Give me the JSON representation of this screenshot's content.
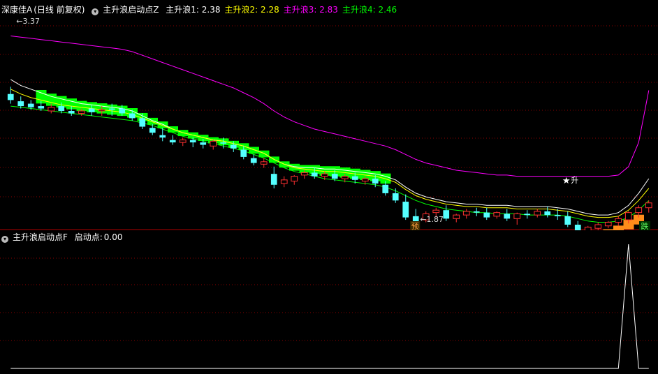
{
  "main_panel": {
    "stock_name": "深康佳A",
    "period_label": "(日线 前复权)",
    "indicator_name": "主升浪启动点Z",
    "lines": [
      {
        "label": "主升浪1:",
        "value": "2.38",
        "color": "#ffffff"
      },
      {
        "label": "主升浪2:",
        "value": "2.28",
        "color": "#ffff00"
      },
      {
        "label": "主升浪3:",
        "value": "2.83",
        "color": "#ff00ff"
      },
      {
        "label": "主升浪4:",
        "value": "2.46",
        "color": "#00ff00"
      }
    ],
    "price_high_label": "3.37",
    "price_low_label": "1.87",
    "marker_yu": "预",
    "marker_die": "跌",
    "marker_sheng": "升"
  },
  "sub_panel": {
    "indicator_name": "主升浪启动点F",
    "series_label": "启动点:",
    "series_value": "0.00"
  },
  "colors": {
    "up": "#ff3030",
    "down": "#54ffff",
    "band": "#00ff00",
    "orange": "#ff8c1a",
    "grid": "#8b0000"
  },
  "chart_data": [
    {
      "type": "candlestick",
      "title": "主升浪启动点Z",
      "ylim": [
        1.72,
        3.45
      ],
      "candles": [
        [
          2.8,
          2.86,
          2.75,
          2.72
        ],
        [
          2.74,
          2.78,
          2.7,
          2.68
        ],
        [
          2.72,
          2.75,
          2.69,
          2.67
        ],
        [
          2.7,
          2.74,
          2.68,
          2.66
        ],
        [
          2.66,
          2.72,
          2.69,
          2.64
        ],
        [
          2.7,
          2.73,
          2.66,
          2.64
        ],
        [
          2.66,
          2.7,
          2.64,
          2.62
        ],
        [
          2.64,
          2.68,
          2.66,
          2.62
        ],
        [
          2.68,
          2.71,
          2.65,
          2.62
        ],
        [
          2.66,
          2.7,
          2.67,
          2.62
        ],
        [
          2.68,
          2.72,
          2.67,
          2.62
        ],
        [
          2.68,
          2.71,
          2.64,
          2.62
        ],
        [
          2.64,
          2.67,
          2.6,
          2.58
        ],
        [
          2.6,
          2.64,
          2.53,
          2.51
        ],
        [
          2.52,
          2.55,
          2.48,
          2.46
        ],
        [
          2.46,
          2.52,
          2.44,
          2.41
        ],
        [
          2.42,
          2.46,
          2.4,
          2.38
        ],
        [
          2.4,
          2.44,
          2.42,
          2.37
        ],
        [
          2.42,
          2.44,
          2.4,
          2.36
        ],
        [
          2.4,
          2.43,
          2.38,
          2.35
        ],
        [
          2.37,
          2.42,
          2.41,
          2.34
        ],
        [
          2.4,
          2.44,
          2.39,
          2.35
        ],
        [
          2.38,
          2.41,
          2.35,
          2.32
        ],
        [
          2.34,
          2.37,
          2.28,
          2.26
        ],
        [
          2.27,
          2.3,
          2.23,
          2.21
        ],
        [
          2.22,
          2.27,
          2.24,
          2.19
        ],
        [
          2.14,
          2.2,
          2.05,
          2.02
        ],
        [
          2.06,
          2.12,
          2.09,
          2.03
        ],
        [
          2.08,
          2.13,
          2.12,
          2.05
        ],
        [
          2.13,
          2.17,
          2.15,
          2.1
        ],
        [
          2.15,
          2.19,
          2.12,
          2.1
        ],
        [
          2.12,
          2.16,
          2.14,
          2.09
        ],
        [
          2.14,
          2.17,
          2.1,
          2.08
        ],
        [
          2.1,
          2.14,
          2.12,
          2.07
        ],
        [
          2.12,
          2.15,
          2.09,
          2.06
        ],
        [
          2.08,
          2.12,
          2.1,
          2.05
        ],
        [
          2.1,
          2.13,
          2.06,
          2.03
        ],
        [
          2.05,
          2.08,
          1.98,
          1.96
        ],
        [
          1.98,
          2.02,
          1.92,
          1.9
        ],
        [
          1.91,
          1.97,
          1.78,
          1.76
        ],
        [
          1.79,
          1.85,
          1.74,
          1.72
        ],
        [
          1.76,
          1.83,
          1.81,
          1.74
        ],
        [
          1.82,
          1.86,
          1.84,
          1.78
        ],
        [
          1.84,
          1.88,
          1.77,
          1.75
        ],
        [
          1.77,
          1.81,
          1.8,
          1.74
        ],
        [
          1.8,
          1.85,
          1.83,
          1.77
        ],
        [
          1.83,
          1.86,
          1.82,
          1.79
        ],
        [
          1.82,
          1.86,
          1.78,
          1.76
        ],
        [
          1.79,
          1.83,
          1.82,
          1.77
        ],
        [
          1.81,
          1.85,
          1.77,
          1.75
        ],
        [
          1.77,
          1.82,
          1.81,
          1.72
        ],
        [
          1.81,
          1.84,
          1.8,
          1.77
        ],
        [
          1.8,
          1.85,
          1.83,
          1.78
        ],
        [
          1.83,
          1.87,
          1.8,
          1.78
        ],
        [
          1.8,
          1.85,
          1.79,
          1.76
        ],
        [
          1.79,
          1.83,
          1.72,
          1.7
        ],
        [
          1.72,
          1.75,
          1.67,
          1.65
        ],
        [
          1.67,
          1.71,
          1.7,
          1.64
        ],
        [
          1.69,
          1.74,
          1.72,
          1.67
        ],
        [
          1.71,
          1.75,
          1.74,
          1.69
        ],
        [
          1.74,
          1.79,
          1.77,
          1.71
        ],
        [
          1.76,
          1.83,
          1.82,
          1.73
        ],
        [
          1.82,
          1.88,
          1.86,
          1.78
        ],
        [
          1.86,
          1.92,
          1.9,
          1.82
        ]
      ],
      "lines": [
        {
          "name": "主升浪1",
          "color": "#ffffff",
          "values": [
            2.92,
            2.87,
            2.84,
            2.81,
            2.78,
            2.76,
            2.74,
            2.72,
            2.71,
            2.7,
            2.69,
            2.68,
            2.66,
            2.62,
            2.58,
            2.55,
            2.51,
            2.48,
            2.46,
            2.44,
            2.42,
            2.41,
            2.39,
            2.37,
            2.34,
            2.31,
            2.26,
            2.22,
            2.2,
            2.19,
            2.19,
            2.18,
            2.18,
            2.17,
            2.16,
            2.15,
            2.14,
            2.12,
            2.09,
            2.03,
            1.98,
            1.95,
            1.93,
            1.91,
            1.9,
            1.89,
            1.89,
            1.88,
            1.88,
            1.88,
            1.87,
            1.87,
            1.87,
            1.87,
            1.86,
            1.85,
            1.83,
            1.81,
            1.8,
            1.8,
            1.82,
            1.88,
            1.98,
            2.1
          ]
        },
        {
          "name": "主升浪2",
          "color": "#ffff00",
          "values": [
            2.84,
            2.8,
            2.77,
            2.75,
            2.73,
            2.71,
            2.7,
            2.69,
            2.68,
            2.67,
            2.66,
            2.65,
            2.63,
            2.6,
            2.57,
            2.54,
            2.51,
            2.48,
            2.46,
            2.44,
            2.42,
            2.41,
            2.39,
            2.37,
            2.34,
            2.31,
            2.26,
            2.22,
            2.19,
            2.18,
            2.17,
            2.16,
            2.16,
            2.15,
            2.14,
            2.13,
            2.12,
            2.1,
            2.07,
            2.01,
            1.96,
            1.93,
            1.91,
            1.89,
            1.88,
            1.87,
            1.87,
            1.86,
            1.86,
            1.86,
            1.85,
            1.85,
            1.85,
            1.85,
            1.84,
            1.83,
            1.81,
            1.79,
            1.78,
            1.78,
            1.79,
            1.84,
            1.92,
            2.02
          ]
        },
        {
          "name": "主升浪3",
          "color": "#ff00ff",
          "values": [
            3.28,
            3.27,
            3.26,
            3.25,
            3.24,
            3.23,
            3.22,
            3.21,
            3.2,
            3.19,
            3.18,
            3.17,
            3.15,
            3.12,
            3.09,
            3.06,
            3.03,
            3.0,
            2.97,
            2.94,
            2.91,
            2.88,
            2.85,
            2.81,
            2.77,
            2.72,
            2.66,
            2.61,
            2.57,
            2.54,
            2.51,
            2.49,
            2.47,
            2.45,
            2.43,
            2.41,
            2.39,
            2.37,
            2.34,
            2.3,
            2.26,
            2.23,
            2.21,
            2.19,
            2.17,
            2.16,
            2.15,
            2.14,
            2.13,
            2.13,
            2.12,
            2.12,
            2.12,
            2.12,
            2.12,
            2.12,
            2.12,
            2.12,
            2.12,
            2.12,
            2.13,
            2.2,
            2.4,
            2.83
          ]
        },
        {
          "name": "主升浪4",
          "color": "#00ff00",
          "values": [
            2.7,
            2.69,
            2.68,
            2.67,
            2.66,
            2.65,
            2.64,
            2.63,
            2.62,
            2.61,
            2.6,
            2.59,
            2.58,
            2.56,
            2.54,
            2.51,
            2.48,
            2.45,
            2.43,
            2.41,
            2.39,
            2.37,
            2.35,
            2.33,
            2.3,
            2.27,
            2.23,
            2.19,
            2.16,
            2.14,
            2.12,
            2.1,
            2.09,
            2.08,
            2.07,
            2.06,
            2.05,
            2.03,
            2.0,
            1.96,
            1.92,
            1.89,
            1.87,
            1.85,
            1.84,
            1.83,
            1.82,
            1.82,
            1.81,
            1.81,
            1.81,
            1.8,
            1.8,
            1.8,
            1.8,
            1.79,
            1.77,
            1.75,
            1.74,
            1.74,
            1.75,
            1.78,
            1.84,
            1.92
          ]
        }
      ],
      "green_band": {
        "from": 3,
        "to": 37
      },
      "orange_band": {
        "from": 56,
        "to": 62
      }
    },
    {
      "type": "line",
      "title": "主升浪启动点F",
      "series": [
        {
          "name": "启动点",
          "values": [
            0,
            0,
            0,
            0,
            0,
            0,
            0,
            0,
            0,
            0,
            0,
            0,
            0,
            0,
            0,
            0,
            0,
            0,
            0,
            0,
            0,
            0,
            0,
            0,
            0,
            0,
            0,
            0,
            0,
            0,
            0,
            0,
            0,
            0,
            0,
            0,
            0,
            0,
            0,
            0,
            0,
            0,
            0,
            0,
            0,
            0,
            0,
            0,
            0,
            0,
            0,
            0,
            0,
            0,
            0,
            0,
            0,
            0,
            0,
            0,
            0,
            1,
            0,
            0
          ]
        }
      ],
      "ylim": [
        0,
        1
      ]
    }
  ]
}
